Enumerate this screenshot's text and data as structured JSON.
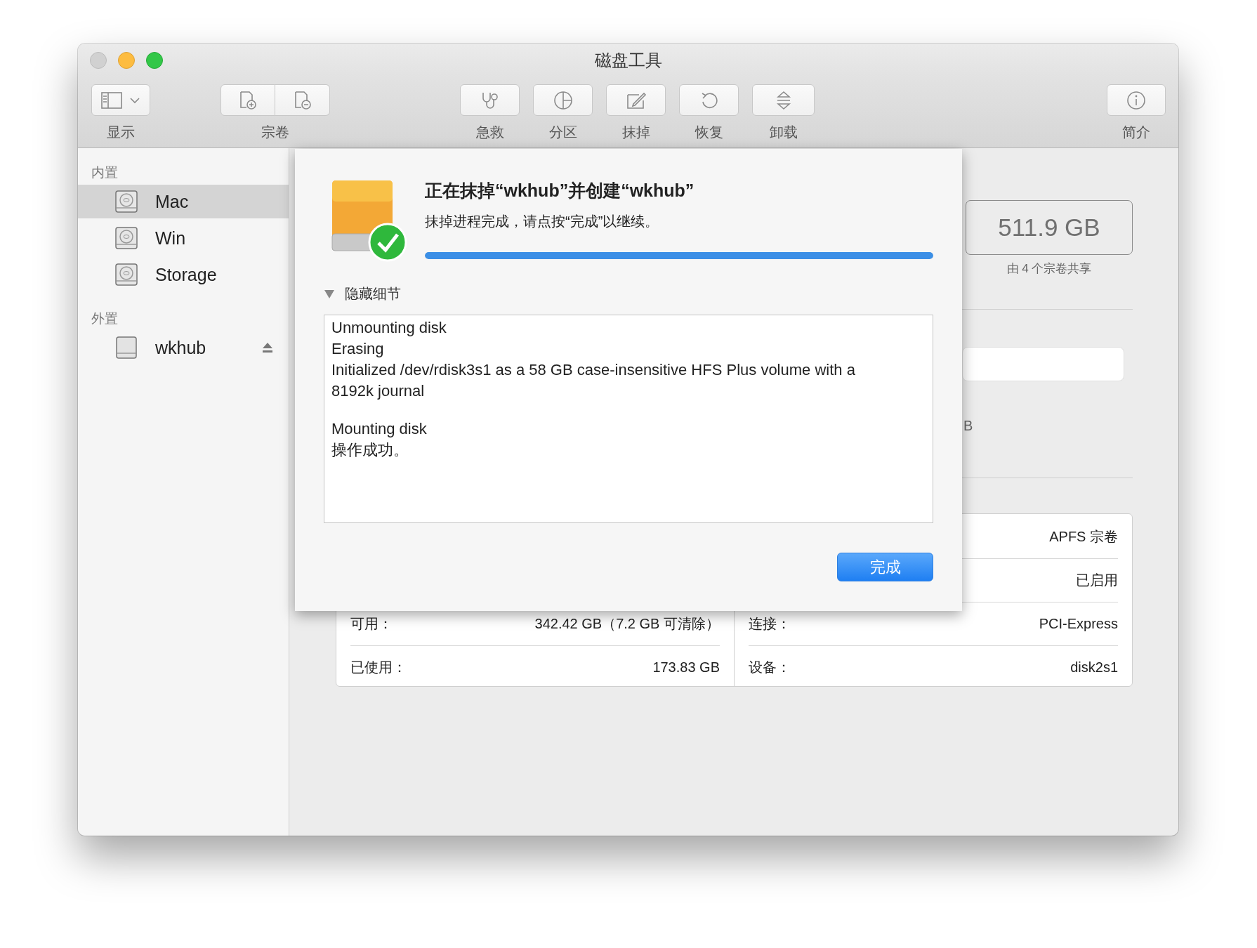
{
  "window": {
    "title": "磁盘工具"
  },
  "toolbar": [
    {
      "kind": "view",
      "label": "显示"
    },
    {
      "kind": "volume",
      "label": "宗卷"
    },
    {
      "kind": "firstaid",
      "label": "急救"
    },
    {
      "kind": "partition",
      "label": "分区"
    },
    {
      "kind": "erase",
      "label": "抹掉"
    },
    {
      "kind": "restore",
      "label": "恢复"
    },
    {
      "kind": "unmount",
      "label": "卸载"
    },
    {
      "kind": "info",
      "label": "简介"
    }
  ],
  "sidebar": {
    "sections": [
      {
        "heading": "内置",
        "items": [
          {
            "label": "Mac",
            "kind": "internal",
            "selected": true,
            "ejectable": false
          },
          {
            "label": "Win",
            "kind": "internal",
            "selected": false,
            "ejectable": false
          },
          {
            "label": "Storage",
            "kind": "internal",
            "selected": false,
            "ejectable": false
          }
        ]
      },
      {
        "heading": "外置",
        "items": [
          {
            "label": "wkhub",
            "kind": "external",
            "selected": false,
            "ejectable": true
          }
        ]
      }
    ]
  },
  "detail": {
    "capacity": "511.9 GB",
    "capacity_note": "由 4 个宗卷共享",
    "partial_text": "B",
    "info_rows": [
      {
        "right_value": "APFS 宗卷"
      },
      {
        "right_value": "已启用"
      },
      {
        "left_label": "可用：",
        "left_value": "342.42 GB（7.2 GB 可清除）",
        "right_label": "连接：",
        "right_value": "PCI-Express"
      },
      {
        "left_label": "已使用：",
        "left_value": "173.83 GB",
        "right_label": "设备：",
        "right_value": "disk2s1"
      }
    ]
  },
  "dialog": {
    "title": "正在抹掉“wkhub”并创建“wkhub”",
    "message": "抹掉进程完成，请点按“完成”以继续。",
    "progress": {
      "level": 1
    },
    "details": {
      "label": "隐藏细节",
      "expanded": true,
      "log": [
        {
          "text": "Unmounting disk",
          "blank_line_after": false
        },
        {
          "text": "Erasing",
          "blank_line_after": false
        },
        {
          "text": "Initialized /dev/rdisk3s1 as a 58 GB case-insensitive HFS Plus volume with a 8192k journal",
          "blank_line_after": true
        },
        {
          "text": "Mounting disk",
          "blank_line_after": false
        },
        {
          "text": "操作成功。",
          "blank_line_after": false
        }
      ]
    },
    "buttons": [
      {
        "label": "完成",
        "default": true
      }
    ]
  }
}
